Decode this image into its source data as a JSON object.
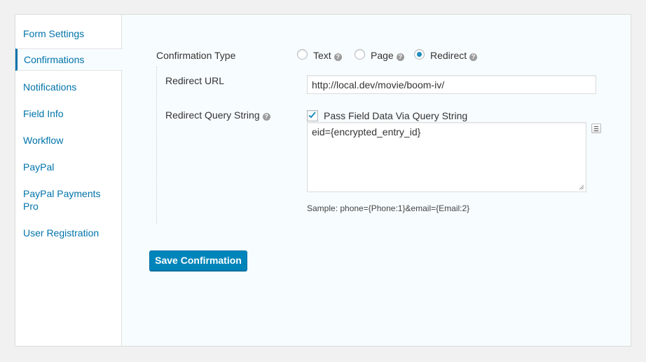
{
  "sidebar": {
    "items": [
      {
        "label": "Form Settings"
      },
      {
        "label": "Confirmations",
        "active": true
      },
      {
        "label": "Notifications"
      },
      {
        "label": "Field Info"
      },
      {
        "label": "Workflow"
      },
      {
        "label": "PayPal"
      },
      {
        "label": "PayPal Payments Pro"
      },
      {
        "label": "User Registration"
      }
    ]
  },
  "confirmation_type": {
    "label": "Confirmation Type",
    "options": [
      {
        "label": "Text",
        "checked": false
      },
      {
        "label": "Page",
        "checked": false
      },
      {
        "label": "Redirect",
        "checked": true
      }
    ]
  },
  "redirect_url": {
    "label": "Redirect URL",
    "value": "http://local.dev/movie/boom-iv/"
  },
  "query_string": {
    "label": "Redirect Query String",
    "checkbox_label": "Pass Field Data Via Query String",
    "checked": true,
    "value": "eid={encrypted_entry_id}",
    "sample": "Sample: phone={Phone:1}&email={Email:2}"
  },
  "save_button": {
    "label": "Save Confirmation"
  },
  "colors": {
    "accent": "#0073aa",
    "button": "#0085ba"
  }
}
